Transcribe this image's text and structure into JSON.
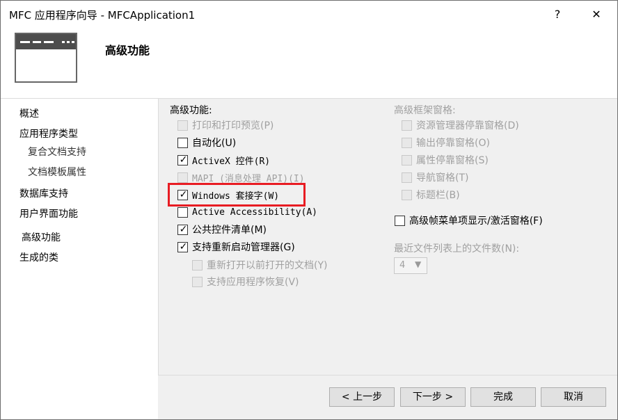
{
  "window": {
    "title": "MFC 应用程序向导 - MFCApplication1",
    "help_label": "?",
    "close_label": "✕"
  },
  "header": {
    "title": "高级功能"
  },
  "sidebar": {
    "items": [
      {
        "label": "概述"
      },
      {
        "label": "应用程序类型"
      },
      {
        "label": "复合文档支持"
      },
      {
        "label": "文档模板属性"
      },
      {
        "label": "数据库支持"
      },
      {
        "label": "用户界面功能"
      },
      {
        "label": "高级功能"
      },
      {
        "label": "生成的类"
      }
    ]
  },
  "advanced": {
    "heading": "高级功能:",
    "items": [
      {
        "label": "打印和打印预览(P)",
        "checked": false,
        "enabled": false
      },
      {
        "label": "自动化(U)",
        "checked": false,
        "enabled": true
      },
      {
        "label": "ActiveX 控件(R)",
        "checked": true,
        "enabled": true
      },
      {
        "label": "MAPI (消息处理 API)(I)",
        "checked": false,
        "enabled": false
      },
      {
        "label": "Windows 套接字(W)",
        "checked": true,
        "enabled": true
      },
      {
        "label": "Active Accessibility(A)",
        "checked": false,
        "enabled": true
      },
      {
        "label": "公共控件清单(M)",
        "checked": true,
        "enabled": true
      },
      {
        "label": "支持重新启动管理器(G)",
        "checked": true,
        "enabled": true
      },
      {
        "label": "重新打开以前打开的文档(Y)",
        "checked": false,
        "enabled": false
      },
      {
        "label": "支持应用程序恢复(V)",
        "checked": false,
        "enabled": false
      }
    ]
  },
  "frame_panes": {
    "heading": "高级框架窗格:",
    "items": [
      {
        "label": "资源管理器停靠窗格(D)",
        "checked": false,
        "enabled": false
      },
      {
        "label": "输出停靠窗格(O)",
        "checked": false,
        "enabled": false
      },
      {
        "label": "属性停靠窗格(S)",
        "checked": false,
        "enabled": false
      },
      {
        "label": "导航窗格(T)",
        "checked": false,
        "enabled": false
      },
      {
        "label": "标题栏(B)",
        "checked": false,
        "enabled": false
      }
    ]
  },
  "advanced_frame_menu": {
    "label": "高级帧菜单项显示/激活窗格(F)",
    "checked": false
  },
  "mru": {
    "label": "最近文件列表上的文件数(N):",
    "value": "4"
  },
  "buttons": {
    "back": "< 上一步",
    "next": "下一步 >",
    "finish": "完成",
    "cancel": "取消"
  },
  "check_glyph": "✓",
  "colors": {
    "highlight": "#e81c23",
    "panel": "#f0f0f0",
    "disabled_text": "#a0a0a0"
  }
}
